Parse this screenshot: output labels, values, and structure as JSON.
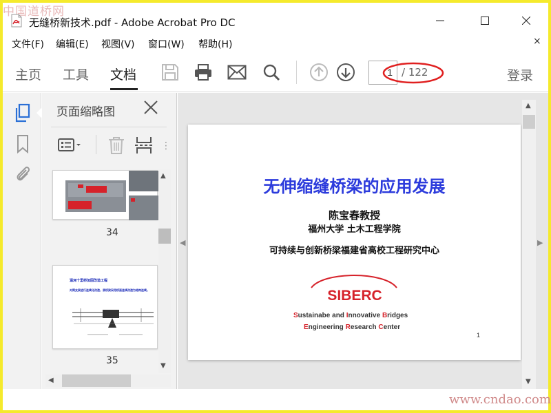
{
  "window": {
    "title": "无缝桥新技术.pdf - Adobe Acrobat Pro DC",
    "icon": "pdf-file-icon"
  },
  "watermark": {
    "top": "中国道桥网",
    "bottom": "www.cndao.com"
  },
  "menu": {
    "items": [
      {
        "label": "文件(F)"
      },
      {
        "label": "编辑(E)"
      },
      {
        "label": "视图(V)"
      },
      {
        "label": "窗口(W)"
      },
      {
        "label": "帮助(H)"
      }
    ],
    "close": "×"
  },
  "toolbar": {
    "tabs": [
      {
        "label": "主页",
        "active": false
      },
      {
        "label": "工具",
        "active": false
      },
      {
        "label": "文档",
        "active": true
      }
    ],
    "icons": [
      "save-icon",
      "print-icon",
      "email-icon",
      "search-icon",
      "prev-page-icon",
      "next-page-icon"
    ],
    "current_page": "1",
    "page_total": "/ 122",
    "login": "登录"
  },
  "sidebar": {
    "icons": [
      "page-thumbnails-icon",
      "bookmark-icon",
      "attachment-icon"
    ],
    "panel_title": "页面缩略图",
    "thumbnails": [
      {
        "label": "34"
      },
      {
        "label": "35"
      }
    ],
    "thumb_35_title": "湄洲十里桥加固改造工程",
    "thumb_35_text": "对简支梁进行连续化改造，原桥梁采用桥面连续改造为结构连续。"
  },
  "document": {
    "title": "无伸缩缝桥梁的应用发展",
    "author": "陈宝春教授",
    "affiliation": "福州大学 土木工程学院",
    "center": "可持续与创新桥梁福建省高校工程研究中心",
    "logo_text": "SIBERC",
    "english_line1": {
      "s1": "S",
      "t1": "ustainabe and ",
      "s2": "I",
      "t2": "nnovative ",
      "s3": "B",
      "t3": "ridges"
    },
    "english_line2": {
      "s1": "E",
      "t1": "ngineering ",
      "s2": "R",
      "t2": "esearch ",
      "s3": "C",
      "t3": "enter"
    },
    "page_number": "1"
  },
  "colors": {
    "frame": "#f5ea2c",
    "doc_title": "#2c3bdc",
    "logo_red": "#d6222a",
    "annotation_red": "#e02020",
    "active_icon": "#2a6fd6"
  }
}
